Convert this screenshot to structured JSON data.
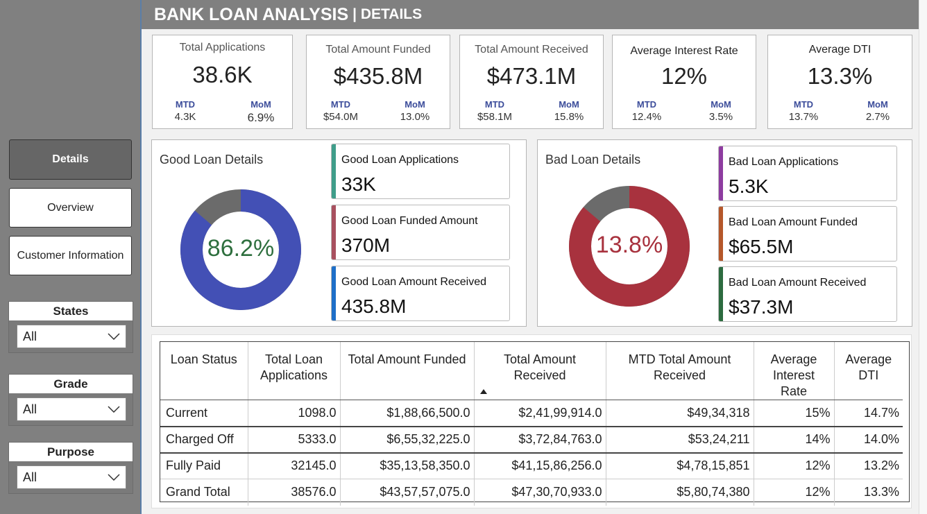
{
  "header": {
    "title": "BANK LOAN ANALYSIS",
    "subtitle": "| DETAILS"
  },
  "nav": {
    "details": "Details",
    "overview": "Overview",
    "customer": "Customer Information"
  },
  "filters": {
    "states": {
      "title": "States",
      "value": "All"
    },
    "grade": {
      "title": "Grade",
      "value": "All"
    },
    "purpose": {
      "title": "Purpose",
      "value": "All"
    }
  },
  "kpis": [
    {
      "title": "Total Applications",
      "value": "38.6K",
      "mtd_label": "MTD",
      "mtd": "4.3K",
      "mom_label": "MoM",
      "mom": "6.9%"
    },
    {
      "title": "Total Amount Funded",
      "value": "$435.8M",
      "mtd_label": "MTD",
      "mtd": "$54.0M",
      "mom_label": "MoM",
      "mom": "13.0%"
    },
    {
      "title": "Total Amount Received",
      "value": "$473.1M",
      "mtd_label": "MTD",
      "mtd": "$58.1M",
      "mom_label": "MoM",
      "mom": "15.8%"
    },
    {
      "title": "Average Interest Rate",
      "value": "12%",
      "mtd_label": "MTD",
      "mtd": "12.4%",
      "mom_label": "MoM",
      "mom": "3.5%"
    },
    {
      "title": "Average DTI",
      "value": "13.3%",
      "mtd_label": "MTD",
      "mtd": "13.7%",
      "mom_label": "MoM",
      "mom": "2.7%"
    }
  ],
  "good_loan": {
    "title": "Good Loan Details",
    "percent_label": "86.2%",
    "percent": 86.2,
    "ring_color": "#4350b5",
    "rest_color": "#6b6b6b",
    "label_color": "#2e6f3e",
    "cards": [
      {
        "title": "Good Loan Applications",
        "value": "33K",
        "color": "#3f9d8a"
      },
      {
        "title": "Good Loan Funded Amount",
        "value": "370M",
        "color": "#a8505f"
      },
      {
        "title": "Good Loan Amount Received",
        "value": "435.8M",
        "color": "#1e6fc8"
      }
    ]
  },
  "bad_loan": {
    "title": "Bad Loan Details",
    "percent_label": "13.8%",
    "percent": 86.2,
    "ring_color": "#a8323e",
    "rest_color": "#6b6b6b",
    "label_color": "#a8323e",
    "cards": [
      {
        "title": "Bad Loan Applications",
        "value": "5.3K",
        "color": "#8e3ca0"
      },
      {
        "title": "Bad Loan Amount Funded",
        "value": "$65.5M",
        "color": "#b5572a"
      },
      {
        "title": "Bad Loan Amount Received",
        "value": "$37.3M",
        "color": "#2c6b3f"
      }
    ]
  },
  "table": {
    "headers": [
      "Loan Status",
      "Total Loan Applications",
      "Total Amount Funded",
      "Total Amount Received",
      "MTD Total Amount Received",
      "Average Interest Rate",
      "Average DTI"
    ],
    "rows": [
      [
        "Current",
        "1098.0",
        "$1,88,66,500.0",
        "$2,41,99,914.0",
        "$49,34,318",
        "15%",
        "14.7%"
      ],
      [
        "Charged Off",
        "5333.0",
        "$6,55,32,225.0",
        "$3,72,84,763.0",
        "$53,24,211",
        "14%",
        "14.0%"
      ],
      [
        "Fully Paid",
        "32145.0",
        "$35,13,58,350.0",
        "$41,15,86,256.0",
        "$4,78,15,851",
        "12%",
        "13.2%"
      ],
      [
        "Grand Total",
        "38576.0",
        "$43,57,57,075.0",
        "$47,30,70,933.0",
        "$5,80,74,380",
        "12%",
        "13.3%"
      ]
    ]
  }
}
